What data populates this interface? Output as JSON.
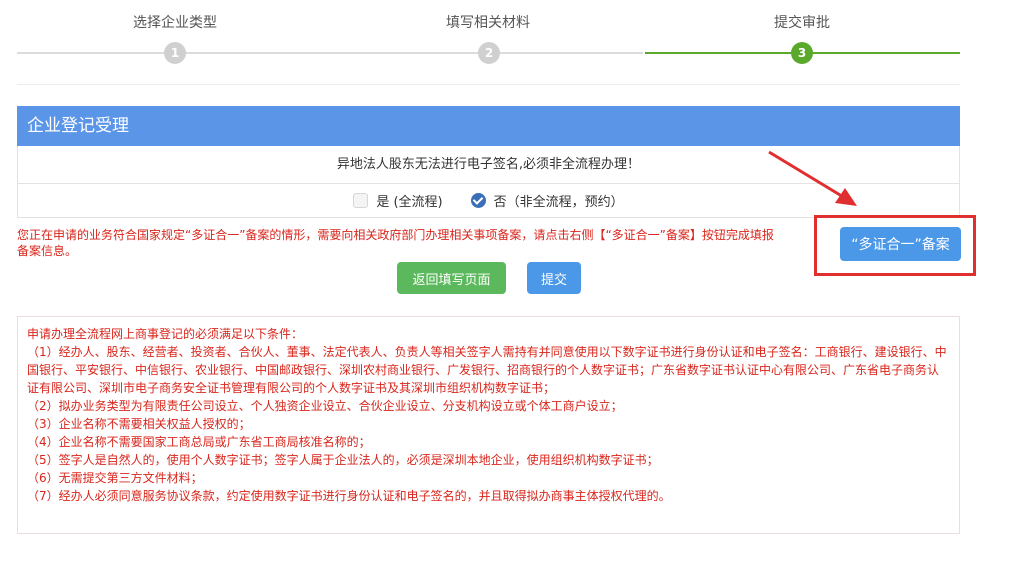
{
  "stepper": {
    "steps": [
      {
        "label": "选择企业类型",
        "number": "1",
        "active": false
      },
      {
        "label": "填写相关材料",
        "number": "2",
        "active": false
      },
      {
        "label": "提交审批",
        "number": "3",
        "active": true
      }
    ]
  },
  "panel": {
    "title": "企业登记受理",
    "notice": "异地法人股东无法进行电子签名,必须非全流程办理！",
    "options": [
      {
        "label": "是 (全流程)",
        "checked": false
      },
      {
        "label": "否（非全流程，预约）",
        "checked": true
      }
    ]
  },
  "note": "您正在申请的业务符合国家规定“多证合一”备案的情形，需要向相关政府部门办理相关事项备案，请点击右侧【“多证合一”备案】按钮完成填报备案信息。",
  "buttons": {
    "back": "返回填写页面",
    "submit": "提交",
    "multi_cert": "“多证合一”备案"
  },
  "conditions": {
    "lines": [
      "申请办理全流程网上商事登记的必须满足以下条件：",
      "（1）经办人、股东、经营者、投资者、合伙人、董事、法定代表人、负责人等相关签字人需持有并同意使用以下数字证书进行身份认证和电子签名：工商银行、建设银行、中国银行、平安银行、中信银行、农业银行、中国邮政银行、深圳农村商业银行、广发银行、招商银行的个人数字证书；广东省数字证书认证中心有限公司、广东省电子商务认证有限公司、深圳市电子商务安全证书管理有限公司的个人数字证书及其深圳市组织机构数字证书；",
      "（2）拟办业务类型为有限责任公司设立、个人独资企业设立、合伙企业设立、分支机构设立或个体工商户设立；",
      "（3）企业名称不需要相关权益人授权的；",
      "（4）企业名称不需要国家工商总局或广东省工商局核准名称的；",
      "（5）签字人是自然人的，使用个人数字证书；签字人属于企业法人的，必须是深圳本地企业，使用组织机构数字证书；",
      "（6）无需提交第三方文件材料；",
      "（7）经办人必须同意服务协议条款，约定使用数字证书进行身份认证和电子签名的，并且取得拟办商事主体授权代理的。"
    ]
  },
  "colors": {
    "header_blue": "#5b95e8",
    "active_green": "#5aa82c",
    "warning_red": "#d9261c",
    "annotation_red": "#e02f2f"
  }
}
